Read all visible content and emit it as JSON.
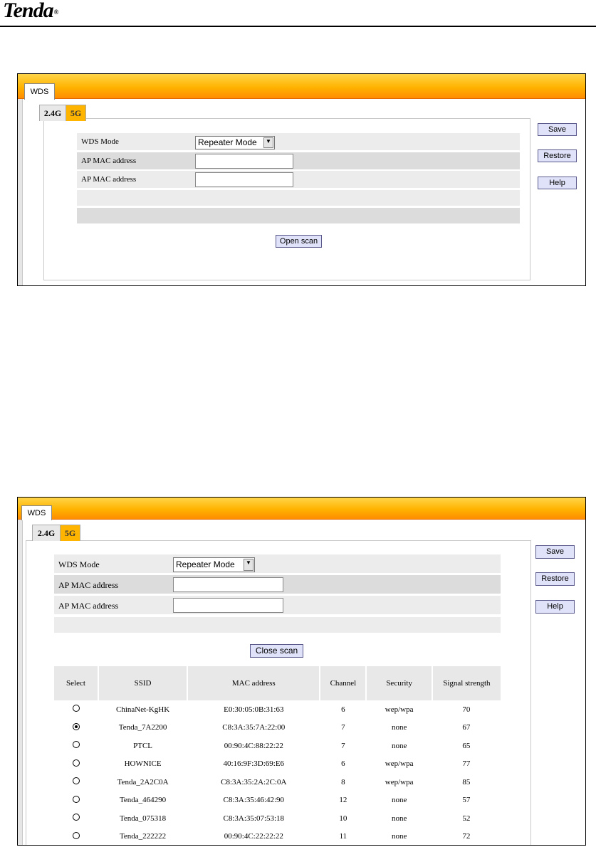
{
  "brand": {
    "logo": "Tenda",
    "reg": "®"
  },
  "screens": [
    {
      "tab": "WDS",
      "band_tabs": [
        "2.4G",
        "5G"
      ],
      "form": {
        "wds_mode_label": "WDS Mode",
        "wds_mode_value": "Repeater Mode",
        "ap_mac_label_1": "AP MAC address",
        "ap_mac_label_2": "AP MAC address",
        "ap_mac_value_1": "",
        "ap_mac_value_2": ""
      },
      "scan_button": "Open scan",
      "side_buttons": {
        "save": "Save",
        "restore": "Restore",
        "help": "Help"
      }
    },
    {
      "tab": "WDS",
      "band_tabs": [
        "2.4G",
        "5G"
      ],
      "form": {
        "wds_mode_label": "WDS Mode",
        "wds_mode_value": "Repeater Mode",
        "ap_mac_label_1": "AP MAC address",
        "ap_mac_label_2": "AP MAC address",
        "ap_mac_value_1": "",
        "ap_mac_value_2": ""
      },
      "scan_button": "Close scan",
      "side_buttons": {
        "save": "Save",
        "restore": "Restore",
        "help": "Help"
      },
      "scan_table": {
        "headers": [
          "Select",
          "SSID",
          "MAC address",
          "Channel",
          "Security",
          "Signal strength"
        ],
        "rows": [
          {
            "selected": false,
            "ssid": "ChinaNet-KgHK",
            "mac": "E0:30:05:0B:31:63",
            "channel": "6",
            "security": "wep/wpa",
            "signal": "70"
          },
          {
            "selected": true,
            "ssid": "Tenda_7A2200",
            "mac": "C8:3A:35:7A:22:00",
            "channel": "7",
            "security": "none",
            "signal": "67"
          },
          {
            "selected": false,
            "ssid": "PTCL",
            "mac": "00:90:4C:88:22:22",
            "channel": "7",
            "security": "none",
            "signal": "65"
          },
          {
            "selected": false,
            "ssid": "HOWNICE",
            "mac": "40:16:9F:3D:69:E6",
            "channel": "6",
            "security": "wep/wpa",
            "signal": "77"
          },
          {
            "selected": false,
            "ssid": "Tenda_2A2C0A",
            "mac": "C8:3A:35:2A:2C:0A",
            "channel": "8",
            "security": "wep/wpa",
            "signal": "85"
          },
          {
            "selected": false,
            "ssid": "Tenda_464290",
            "mac": "C8:3A:35:46:42:90",
            "channel": "12",
            "security": "none",
            "signal": "57"
          },
          {
            "selected": false,
            "ssid": "Tenda_075318",
            "mac": "C8:3A:35:07:53:18",
            "channel": "10",
            "security": "none",
            "signal": "52"
          },
          {
            "selected": false,
            "ssid": "Tenda_222222",
            "mac": "00:90:4C:22:22:22",
            "channel": "11",
            "security": "none",
            "signal": "72"
          }
        ]
      }
    }
  ]
}
